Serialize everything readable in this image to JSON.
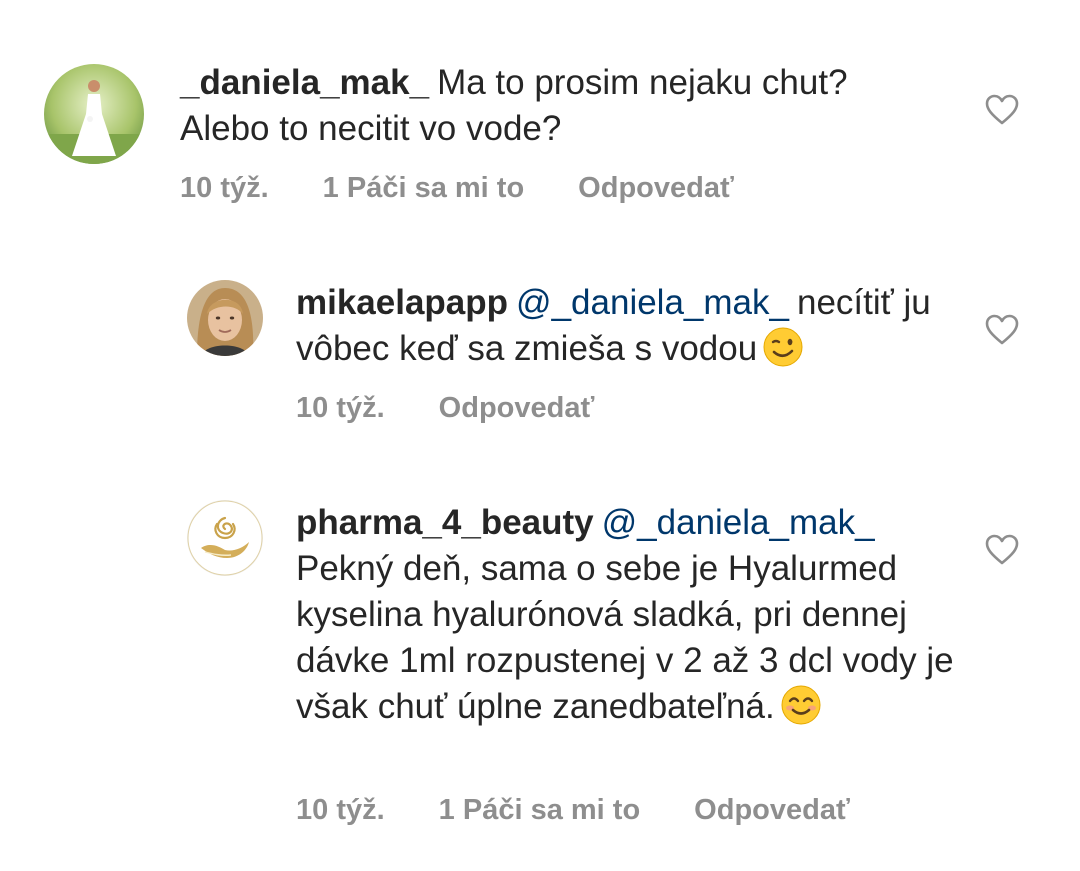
{
  "comments": [
    {
      "username": "_daniela_mak_",
      "mention": "",
      "text": "Ma to prosim nejaku chut? Alebo to necitit vo vode?",
      "time": "10 týž.",
      "likes": "1 Páči sa mi to",
      "reply_label": "Odpovedať",
      "avatar_icon": "bride-photo-avatar"
    },
    {
      "username": "mikaelapapp",
      "mention": "@_daniela_mak_",
      "text": "necítiť ju vôbec keď sa zmieša s vodou",
      "emoji": "winking-face-emoji",
      "time": "10 týž.",
      "likes": "",
      "reply_label": "Odpovedať",
      "avatar_icon": "woman-portrait-avatar"
    },
    {
      "username": "pharma_4_beauty",
      "mention": "@_daniela_mak_",
      "text": "Pekný deň, sama o sebe je Hyalurmed kyselina hyalurónová sladká, pri dennej dávke 1ml rozpustenej v 2 až 3 dcl vody je však chuť úplne zanedbateľná.",
      "emoji": "smiling-face-emoji",
      "time": "10 týž.",
      "likes": "1 Páči sa mi to",
      "reply_label": "Odpovedať",
      "avatar_icon": "gold-rose-hand-logo"
    }
  ],
  "colors": {
    "text": "#262626",
    "muted": "#8e8e8e",
    "mention": "#00376b"
  }
}
